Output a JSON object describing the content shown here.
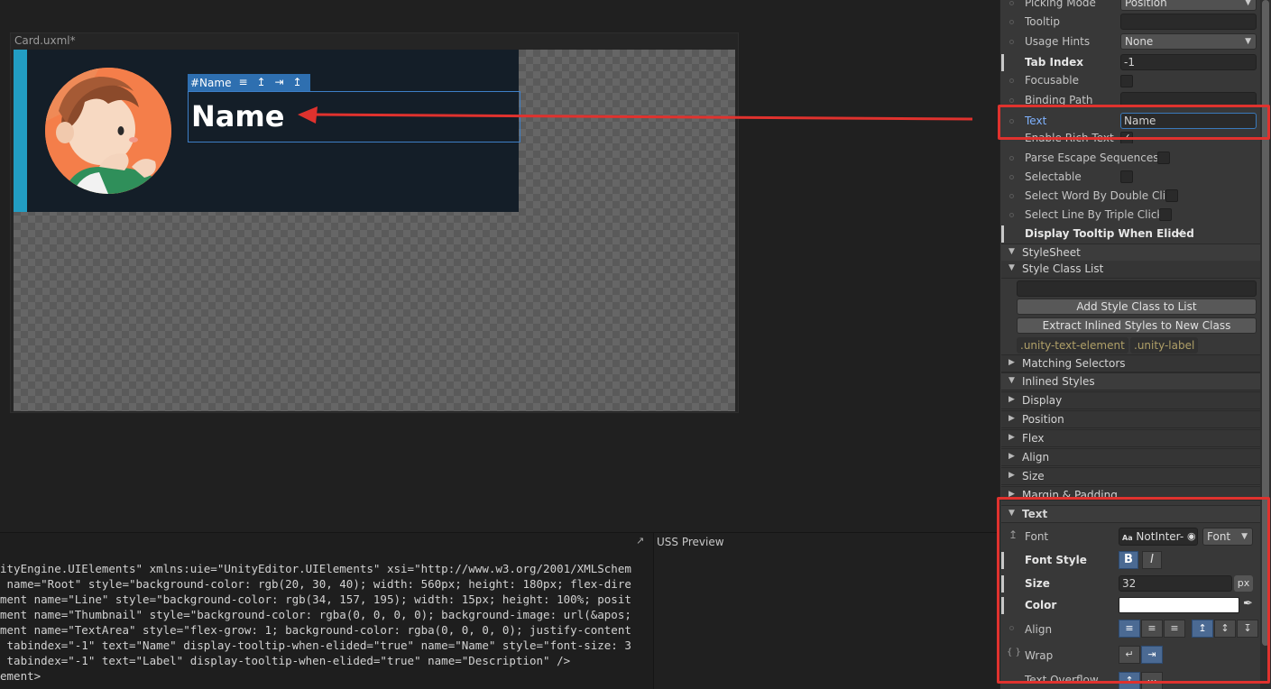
{
  "canvas": {
    "document_title": "Card.uxml*",
    "selected_element_tag": "#Name",
    "name_text": "Name"
  },
  "code_panel": {
    "lines": [
      "ityEngine.UIElements\" xmlns:uie=\"UnityEditor.UIElements\" xsi=\"http://www.w3.org/2001/XMLSchem",
      " name=\"Root\" style=\"background-color: rgb(20, 30, 40); width: 560px; height: 180px; flex-dire",
      "ment name=\"Line\" style=\"background-color: rgb(34, 157, 195); width: 15px; height: 100%; posit",
      "ment name=\"Thumbnail\" style=\"background-color: rgba(0, 0, 0, 0); background-image: url(&apos;",
      "ment name=\"TextArea\" style=\"flex-grow: 1; background-color: rgba(0, 0, 0, 0); justify-content",
      " tabindex=\"-1\" text=\"Name\" display-tooltip-when-elided=\"true\" name=\"Name\" style=\"font-size: 3",
      " tabindex=\"-1\" text=\"Label\" display-tooltip-when-elided=\"true\" name=\"Description\" />",
      "ement>"
    ],
    "uss_preview_label": "USS Preview"
  },
  "inspector": {
    "picking_mode": {
      "label": "Picking Mode",
      "value": "Position"
    },
    "tooltip": {
      "label": "Tooltip",
      "value": ""
    },
    "usage_hints": {
      "label": "Usage Hints",
      "value": "None"
    },
    "tab_index": {
      "label": "Tab Index",
      "value": "-1"
    },
    "focusable": {
      "label": "Focusable"
    },
    "binding_path": {
      "label": "Binding Path"
    },
    "text": {
      "label": "Text",
      "value": "Name"
    },
    "enable_rich_text": {
      "label": "Enable Rich Text"
    },
    "parse_escape": {
      "label": "Parse Escape Sequences"
    },
    "selectable": {
      "label": "Selectable"
    },
    "select_word": {
      "label": "Select Word By Double Click"
    },
    "select_line": {
      "label": "Select Line By Triple Click"
    },
    "display_tooltip": {
      "label": "Display Tooltip When Elided"
    },
    "stylesheet_section": "StyleSheet",
    "style_class_list_section": "Style Class List",
    "add_style_class_button": "Add Style Class to List",
    "extract_styles_button": "Extract Inlined Styles to New Class",
    "class_chips": [
      ".unity-text-element",
      ".unity-label"
    ],
    "matching_selectors_section": "Matching Selectors",
    "inlined_styles_section": "Inlined Styles",
    "style_groups": [
      "Display",
      "Position",
      "Flex",
      "Align",
      "Size",
      "Margin & Padding"
    ],
    "text_section": "Text",
    "font": {
      "label": "Font",
      "value": "NotInter-",
      "asset_type": "Font"
    },
    "font_style": {
      "label": "Font Style",
      "bold": "B",
      "italic": "I"
    },
    "size": {
      "label": "Size",
      "value": "32",
      "unit": "px"
    },
    "color": {
      "label": "Color",
      "value": "#ffffff"
    },
    "align": {
      "label": "Align"
    },
    "wrap": {
      "label": "Wrap"
    },
    "text_overflow": {
      "label": "Text Overflow"
    }
  }
}
